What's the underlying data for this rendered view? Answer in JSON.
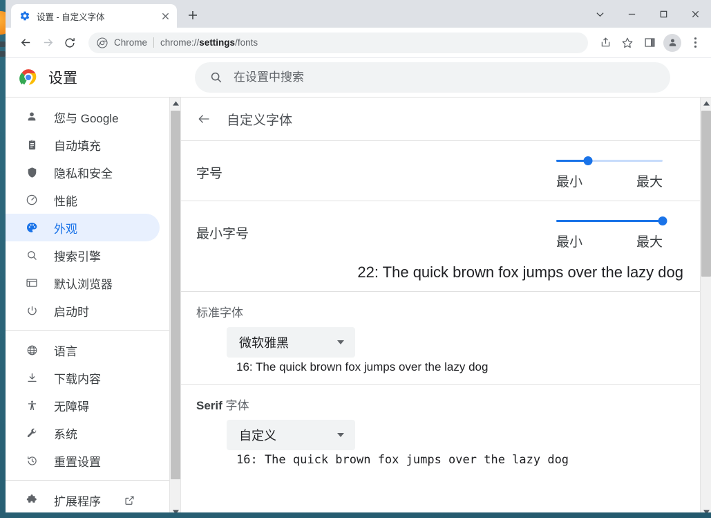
{
  "desktop": {
    "orb": "firefox-orb"
  },
  "tab": {
    "favicon": "gear-icon",
    "title": "设置 - 自定义字体",
    "close_label": "✕",
    "newtab_label": "+"
  },
  "window_controls": {
    "tab_search": "tab-search-chevron",
    "minimize": "minimize",
    "maximize": "maximize",
    "close": "close"
  },
  "toolbar": {
    "back": "back-arrow",
    "forward": "forward-arrow",
    "reload": "reload",
    "omnibox": {
      "icon": "chrome-icon",
      "scheme_label": "Chrome",
      "url_prefix": "chrome://",
      "url_bold": "settings",
      "url_suffix": "/fonts",
      "full_url": "chrome://settings/fonts"
    },
    "share": "share-icon",
    "bookmark": "star-icon",
    "side_panel": "side-panel-icon",
    "profile": "avatar",
    "menu": "three-dot-menu"
  },
  "settings_header": {
    "brand_title": "设置",
    "logo": "chrome-logo"
  },
  "search": {
    "placeholder": "在设置中搜索",
    "value": "",
    "icon": "search-icon"
  },
  "sidebar": {
    "groups": [
      {
        "items": [
          {
            "label": "您与 Google",
            "icon": "person-icon",
            "selected": false
          },
          {
            "label": "自动填充",
            "icon": "clipboard-icon",
            "selected": false
          },
          {
            "label": "隐私和安全",
            "icon": "shield-icon",
            "selected": false
          },
          {
            "label": "性能",
            "icon": "gauge-icon",
            "selected": false
          },
          {
            "label": "外观",
            "icon": "palette-icon",
            "selected": true
          },
          {
            "label": "搜索引擎",
            "icon": "search-icon",
            "selected": false
          },
          {
            "label": "默认浏览器",
            "icon": "browser-window-icon",
            "selected": false
          },
          {
            "label": "启动时",
            "icon": "power-icon",
            "selected": false
          }
        ]
      },
      {
        "items": [
          {
            "label": "语言",
            "icon": "globe-icon",
            "selected": false
          },
          {
            "label": "下载内容",
            "icon": "download-icon",
            "selected": false
          },
          {
            "label": "无障碍",
            "icon": "accessibility-icon",
            "selected": false
          },
          {
            "label": "系统",
            "icon": "wrench-icon",
            "selected": false
          },
          {
            "label": "重置设置",
            "icon": "restore-icon",
            "selected": false
          }
        ]
      },
      {
        "items": [
          {
            "label": "扩展程序",
            "icon": "puzzle-icon",
            "selected": false,
            "external": true
          }
        ]
      }
    ]
  },
  "page": {
    "back_icon": "back-arrow-icon",
    "title": "自定义字体"
  },
  "font_size": {
    "label": "字号",
    "min_label": "最小",
    "max_label": "最大",
    "percent": 30,
    "sample": ""
  },
  "min_font_size": {
    "label": "最小字号",
    "min_label": "最小",
    "max_label": "最大",
    "percent": 100,
    "sample": "22: The quick brown fox jumps over the lazy dog"
  },
  "standard_font": {
    "label": "标准字体",
    "value": "微软雅黑",
    "caret": "chevron-down-icon",
    "sample": "16: The quick brown fox jumps over the lazy dog"
  },
  "serif_font": {
    "label_bold": "Serif",
    "label_rest": " 字体",
    "value": "自定义",
    "caret": "chevron-down-icon",
    "sample": "16: The quick brown fox jumps over the lazy dog"
  },
  "scrollbars": {
    "sidebar": {
      "thumb_top_pct": 3,
      "thumb_height_pct": 88
    },
    "main": {
      "thumb_top_pct": 3,
      "thumb_height_pct": 40
    }
  }
}
